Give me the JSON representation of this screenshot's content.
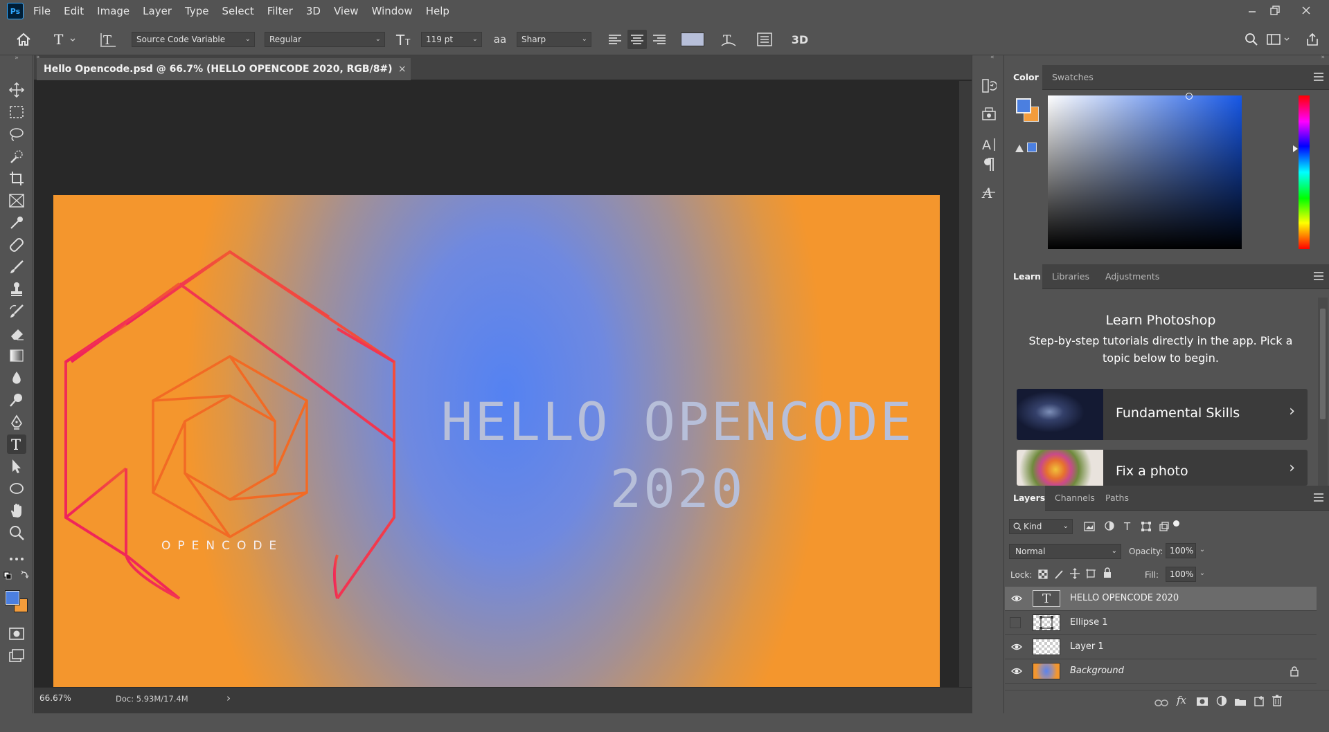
{
  "app": {
    "logo": "Ps"
  },
  "menu": [
    "File",
    "Edit",
    "Image",
    "Layer",
    "Type",
    "Select",
    "Filter",
    "3D",
    "View",
    "Window",
    "Help"
  ],
  "options": {
    "font_family": "Source Code Variable",
    "font_style": "Regular",
    "font_size": "119 pt",
    "antialias_label": "aa",
    "antialias": "Sharp",
    "threeD_label": "3D",
    "text_color": "#b7bfd9"
  },
  "document": {
    "tab_title": "Hello Opencode.psd @ 66.7% (HELLO OPENCODE  2020, RGB/8#)",
    "tab_close": "×",
    "headline_line1": "HELLO OPENCODE",
    "headline_line2": "2020",
    "logo_text": "OPENCODE"
  },
  "status": {
    "zoom": "66.67%",
    "doc": "Doc: 5.93M/17.4M",
    "arrow": "›"
  },
  "color_panel": {
    "tabs": [
      "Color",
      "Swatches"
    ],
    "foreground": "#4b7fe0",
    "background": "#f39c3b"
  },
  "learn_panel": {
    "tabs": [
      "Learn",
      "Libraries",
      "Adjustments"
    ],
    "title": "Learn Photoshop",
    "subtitle": "Step-by-step tutorials directly in the app. Pick a topic below to begin.",
    "cards": [
      {
        "label": "Fundamental Skills",
        "chevron": "›"
      },
      {
        "label": "Fix a photo",
        "chevron": "›"
      }
    ]
  },
  "layers_panel": {
    "tabs": [
      "Layers",
      "Channels",
      "Paths"
    ],
    "filter": "Kind",
    "blend_mode": "Normal",
    "opacity_label": "Opacity:",
    "opacity": "100%",
    "lock_label": "Lock:",
    "fill_label": "Fill:",
    "fill": "100%",
    "type_glyph": "T",
    "fx_label": "fx",
    "layers": [
      {
        "name": "HELLO OPENCODE  2020",
        "visible": true,
        "selected": true
      },
      {
        "name": "Ellipse 1",
        "visible": false,
        "selected": false
      },
      {
        "name": "Layer 1",
        "visible": true,
        "selected": false
      },
      {
        "name": "Background",
        "visible": true,
        "selected": false
      }
    ]
  }
}
